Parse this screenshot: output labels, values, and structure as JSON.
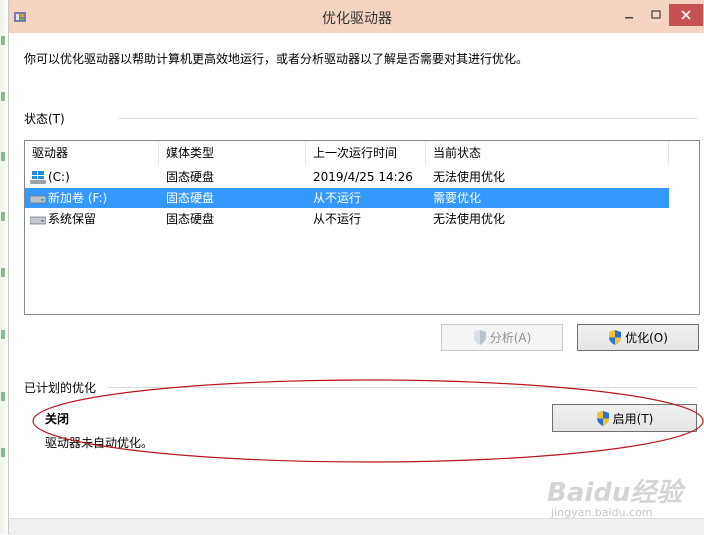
{
  "window": {
    "title": "优化驱动器",
    "minimize_glyph": "–",
    "maximize_glyph": "□",
    "close_glyph": "✕"
  },
  "intro_text": "你可以优化驱动器以帮助计算机更高效地运行，或者分析驱动器以了解是否需要对其进行优化。",
  "status_section": {
    "label": "状态(T)",
    "columns": [
      "驱动器",
      "媒体类型",
      "上一次运行时间",
      "当前状态"
    ],
    "rows": [
      {
        "drive": "(C:)",
        "media": "固态硬盘",
        "last_run": "2019/4/25 14:26",
        "status": "无法使用优化",
        "icon": "windows-drive-icon",
        "selected": false
      },
      {
        "drive": "新加卷 (F:)",
        "media": "固态硬盘",
        "last_run": "从不运行",
        "status": "需要优化",
        "icon": "drive-icon",
        "selected": true
      },
      {
        "drive": "系统保留",
        "media": "固态硬盘",
        "last_run": "从不运行",
        "status": "无法使用优化",
        "icon": "drive-icon",
        "selected": false
      }
    ],
    "analyze_button": "分析(A)",
    "optimize_button": "优化(O)"
  },
  "scheduled_section": {
    "label": "已计划的优化",
    "status": "关闭",
    "description": "驱动器未自动优化。",
    "enable_button": "启用(T)"
  },
  "watermark": {
    "brand": "Baidu经验",
    "url": "jingyan.baidu.com"
  },
  "colors": {
    "title_bar": "#f5d4c4",
    "close_button": "#c75050",
    "selection": "#3399ff",
    "annotation": "#b8171f"
  }
}
